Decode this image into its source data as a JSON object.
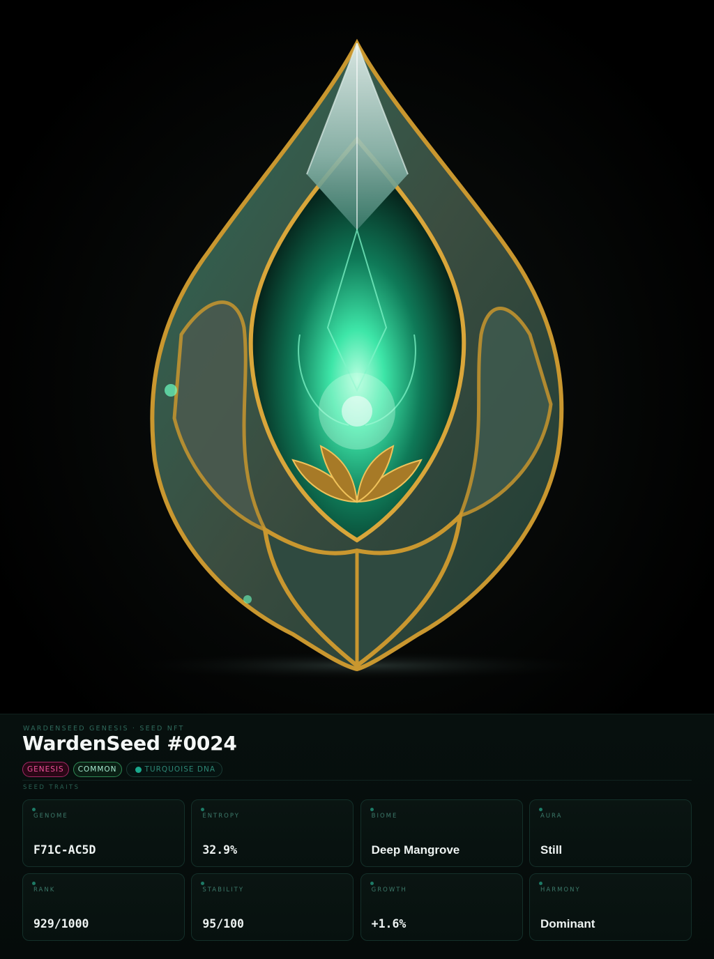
{
  "artwork": {
    "subject": "crystal-seed-icon",
    "colors": {
      "crystal": "#2ed89a",
      "gold": "#c9972f",
      "stone": "#3a4a40",
      "glow": "#6effc2"
    }
  },
  "header": {
    "eyebrow": "WARDENSEED GENESIS · SEED NFT",
    "title": "WardenSeed #0024"
  },
  "badges": {
    "genesis": "GENESIS",
    "common": "COMMON",
    "dna": "TURQUOISE DNA"
  },
  "traits": {
    "section_label": "SEED TRAITS",
    "items": [
      {
        "label": "GENOME",
        "value": "F71C-AC5D"
      },
      {
        "label": "ENTROPY",
        "value": "32.9%"
      },
      {
        "label": "BIOME",
        "value": "Deep Mangrove"
      },
      {
        "label": "AURA",
        "value": "Still"
      },
      {
        "label": "RANK",
        "value": "929/1000"
      },
      {
        "label": "STABILITY",
        "value": "95/100"
      },
      {
        "label": "GROWTH",
        "value": "+1.6%"
      },
      {
        "label": "HARMONY",
        "value": "Dominant"
      }
    ]
  },
  "colors": {
    "accent": "#19a88c",
    "genesis": "#f0519b",
    "common": "#a6ead0",
    "panel_bg": "#050b0a"
  }
}
